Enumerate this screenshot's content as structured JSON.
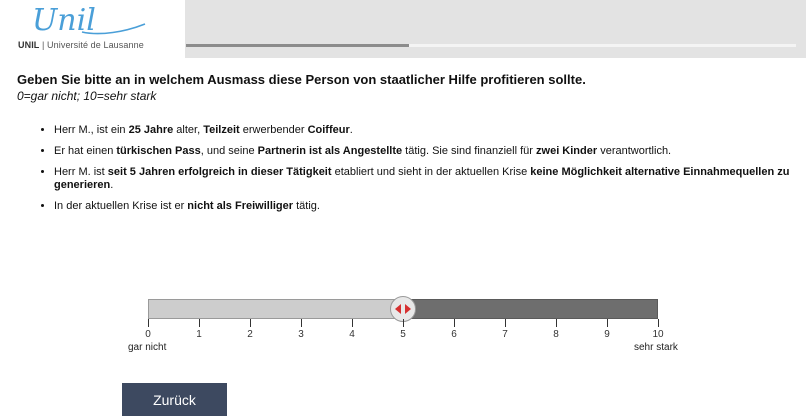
{
  "header": {
    "logo_text": "Unil",
    "logo_subtitle_bold": "UNIL",
    "logo_subtitle_rest": " | Université de Lausanne",
    "progress": 0.365
  },
  "question": {
    "title": "Geben Sie bitte an in welchem Ausmass diese Person von staatlicher Hilfe profitieren sollte.",
    "scale_note": "0=gar nicht; 10=sehr stark"
  },
  "bullets": [
    [
      {
        "t": "Herr M., ist ein ",
        "b": false
      },
      {
        "t": "25 Jahre",
        "b": true
      },
      {
        "t": " alter, ",
        "b": false
      },
      {
        "t": "Teilzeit",
        "b": true
      },
      {
        "t": " erwerbender ",
        "b": false
      },
      {
        "t": "Coiffeur",
        "b": true
      },
      {
        "t": ".",
        "b": false
      }
    ],
    [
      {
        "t": "Er hat einen ",
        "b": false
      },
      {
        "t": "türkischen Pass",
        "b": true
      },
      {
        "t": ", und seine ",
        "b": false
      },
      {
        "t": "Partnerin ist als Angestellte",
        "b": true
      },
      {
        "t": " tätig. Sie sind finanziell für ",
        "b": false
      },
      {
        "t": "zwei Kinder",
        "b": true
      },
      {
        "t": " verantwortlich.",
        "b": false
      }
    ],
    [
      {
        "t": "Herr M. ist ",
        "b": false
      },
      {
        "t": "seit 5 Jahren erfolgreich in dieser Tätigkeit",
        "b": true
      },
      {
        "t": " etabliert und sieht in der aktuellen Krise ",
        "b": false
      },
      {
        "t": "keine Möglichkeit alternative Einnahmequellen zu generieren",
        "b": true
      },
      {
        "t": ".",
        "b": false
      }
    ],
    [
      {
        "t": "In der aktuellen Krise ist er ",
        "b": false
      },
      {
        "t": "nicht als Freiwilliger",
        "b": true
      },
      {
        "t": " tätig.",
        "b": false
      }
    ]
  ],
  "slider": {
    "min": 0,
    "max": 10,
    "value": 5,
    "tick_labels": [
      "0",
      "1",
      "2",
      "3",
      "4",
      "5",
      "6",
      "7",
      "8",
      "9",
      "10"
    ],
    "min_label": "gar nicht",
    "max_label": "sehr stark"
  },
  "buttons": {
    "back_label": "Zurück"
  },
  "colors": {
    "header_bg": "#e3e3e3",
    "logo_blue": "#4a9fd8",
    "button_bg": "#3d4960",
    "handle_arrow": "#d63030"
  }
}
